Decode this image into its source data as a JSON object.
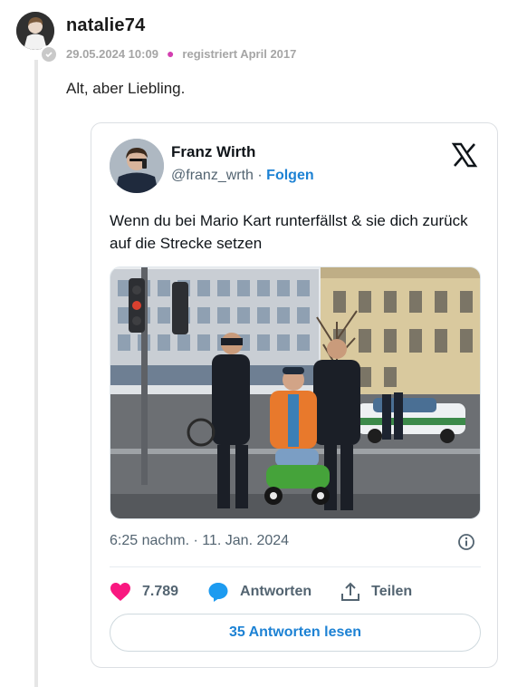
{
  "post": {
    "username": "natalie74",
    "timestamp": "29.05.2024 10:09",
    "registered": "registriert April 2017",
    "comment": "Alt, aber Liebling."
  },
  "tweet": {
    "author_name": "Franz Wirth",
    "handle": "@franz_wrth",
    "separator": "·",
    "follow_label": "Folgen",
    "text": "Wenn du bei Mario Kart runterfällst & sie dich zurück auf die Strecke setzen",
    "timestamp": "6:25 nachm. · 11. Jan. 2024",
    "likes": "7.789",
    "reply_label": "Antworten",
    "share_label": "Teilen",
    "read_replies_label": "35 Antworten lesen",
    "icons": [
      "x-logo-icon",
      "heart-icon",
      "reply-bubble-icon",
      "share-icon",
      "info-icon"
    ]
  },
  "colors": {
    "accent_blue": "#1d82d4",
    "like_pink": "#f91880",
    "meta_dot": "#d33fb0"
  }
}
